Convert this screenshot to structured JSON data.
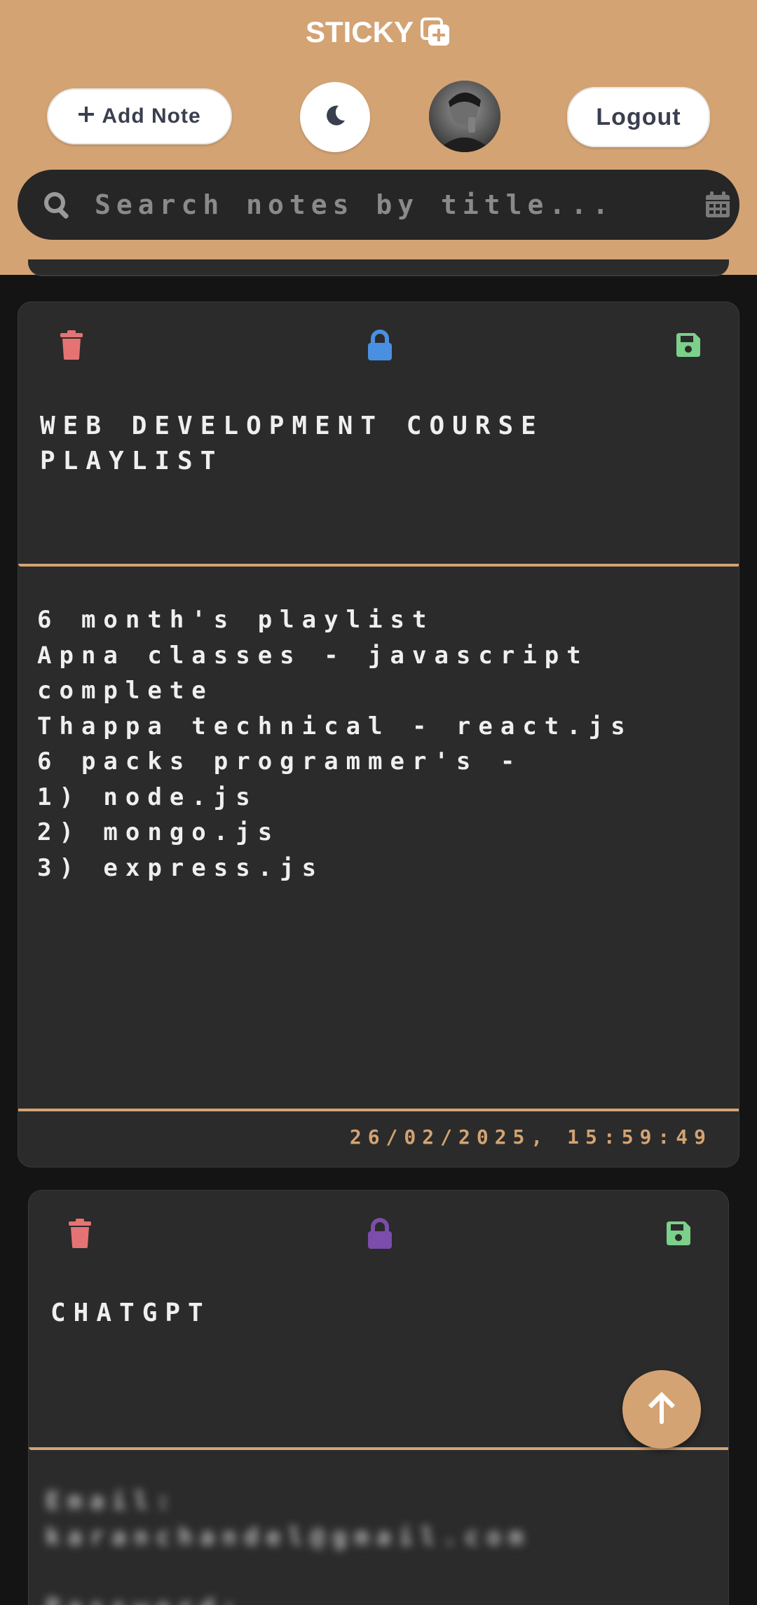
{
  "app": {
    "title": "STICKY"
  },
  "header": {
    "add_note_label": "Add Note",
    "logout_label": "Logout",
    "search_placeholder": "Search notes by title..."
  },
  "notes": [
    {
      "title": "WEB DEVELOPMENT COURSE\nPLAYLIST",
      "content": "6 month's playlist\nApna classes - javascript\ncomplete\nThappa technical - react.js\n6 packs programmer's -\n1) node.js\n2) mongo.js\n3) express.js",
      "timestamp": "26/02/2025, 15:59:49",
      "lock_color": "#4a90e2"
    },
    {
      "title": "CHATGPT",
      "content": "Email:\nkaranchandel@gmail.com\n\nPassword:",
      "lock_color": "#7c4dab"
    }
  ],
  "colors": {
    "accent": "#d4a373",
    "delete": "#e57373",
    "save": "#7bd08a",
    "background": "#141414",
    "card": "#2b2b2b"
  },
  "icons": [
    "brand-add-icon",
    "plus-icon",
    "moon-icon",
    "search-icon",
    "calendar-icon",
    "trash-icon",
    "lock-icon",
    "save-icon",
    "arrow-up-icon"
  ]
}
